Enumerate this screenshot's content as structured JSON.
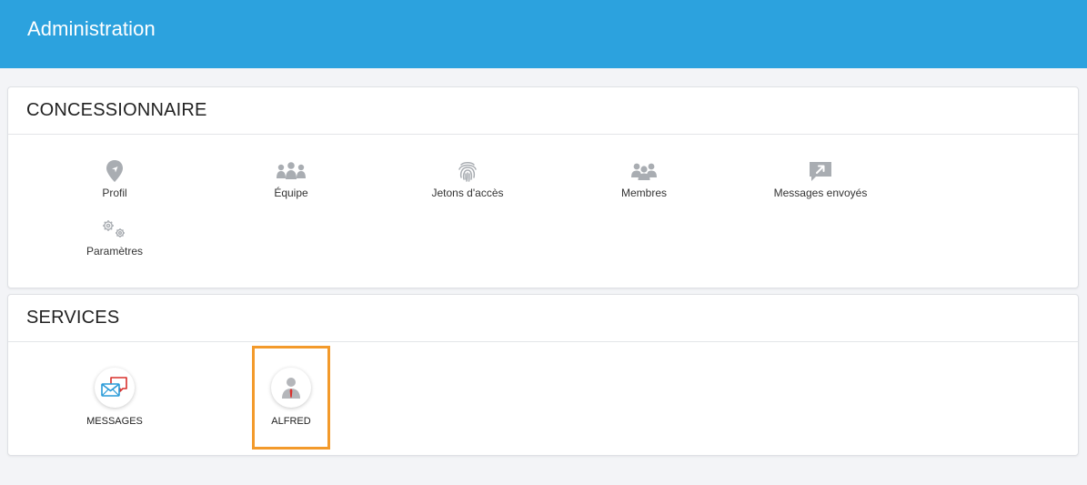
{
  "header": {
    "title": "Administration",
    "color": "#2ca2de"
  },
  "concessionnaire": {
    "title": "CONCESSIONNAIRE",
    "items": [
      {
        "label": "Profil",
        "icon": "location-pin-icon"
      },
      {
        "label": "Équipe",
        "icon": "team-icon"
      },
      {
        "label": "Jetons d'accès",
        "icon": "fingerprint-icon"
      },
      {
        "label": "Membres",
        "icon": "members-icon"
      },
      {
        "label": "Messages envoyés",
        "icon": "sent-message-icon"
      },
      {
        "label": "Paramètres",
        "icon": "gears-icon"
      }
    ]
  },
  "services": {
    "title": "SERVICES",
    "items": [
      {
        "label": "MESSAGES",
        "icon": "messages-icon"
      },
      {
        "label": "ALFRED",
        "icon": "user-avatar-icon",
        "highlighted": true
      }
    ]
  },
  "highlight_color": "#f39a2b"
}
